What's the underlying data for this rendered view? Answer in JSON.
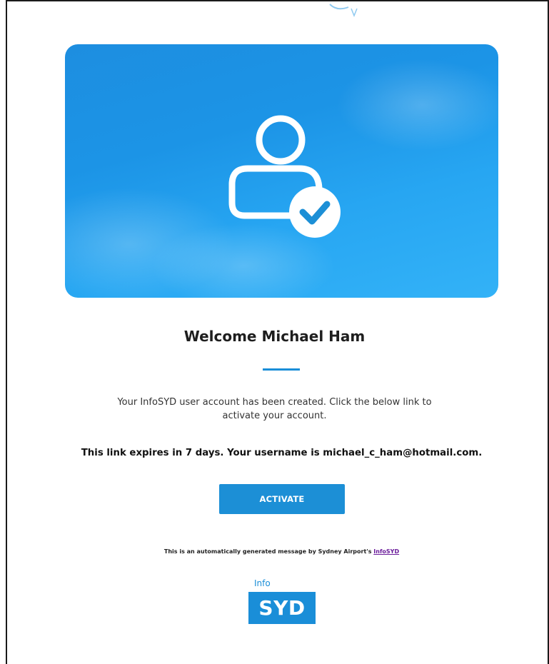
{
  "email": {
    "welcome_heading": "Welcome Michael Ham",
    "body_text": "Your InfoSYD user account has been created. Click the below link to activate your account.",
    "expiry_text": "This link expires in 7 days. Your username is michael_c_ham@hotmail.com.",
    "activate_label": "ACTIVATE",
    "footer_prefix": "This is an automatically generated message by Sydney Airport's ",
    "footer_link": "InfoSYD"
  },
  "logo": {
    "info_label": "Info",
    "syd_label": "SYD"
  },
  "icons": {
    "hero_icon": "user-check-icon"
  },
  "colors": {
    "brand_blue": "#1a8ed8",
    "hero_gradient_start": "#1d8ee0",
    "hero_gradient_end": "#33b2f7",
    "link_purple": "#6a1b9a"
  }
}
